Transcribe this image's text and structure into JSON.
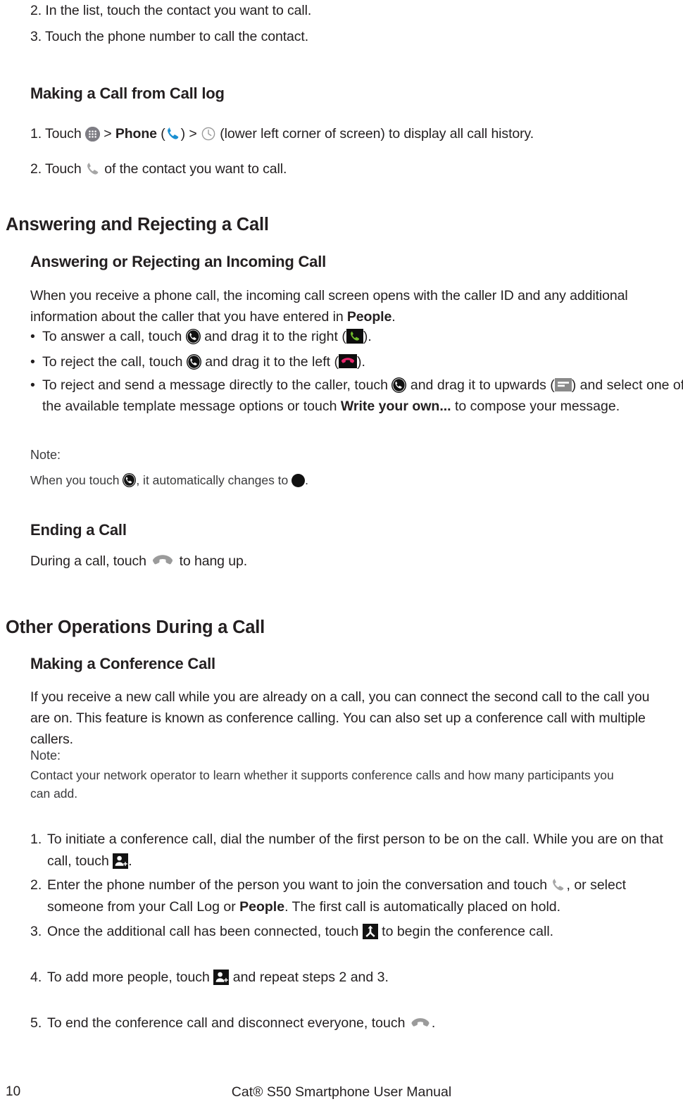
{
  "document": {
    "footer": {
      "page_number": "10",
      "title": "Cat® S50 Smartphone User Manual"
    }
  },
  "top_steps": {
    "step2": "2. In the list, touch the contact you want to call.",
    "step3": "3. Touch the phone number to call the contact."
  },
  "section_call_log": {
    "heading": "Making a Call from Call log",
    "step1_a": "1. Touch ",
    "step1_b": " > ",
    "step1_phone_label": "Phone",
    "step1_c": " (",
    "step1_d": ") > ",
    "step1_e": " (lower left corner of screen) to display all call history.",
    "step2_a": "2. Touch ",
    "step2_b": " of the contact you want to call."
  },
  "section_answer_reject": {
    "heading": "Answering and Rejecting a Call",
    "subheading": "Answering or Rejecting an Incoming Call",
    "intro_a": "When you receive a phone call, the incoming call screen opens with the caller ID and any additional information about the caller that you have entered in ",
    "intro_people": "People",
    "intro_b": ".",
    "bullet1_a": "To answer a call, touch ",
    "bullet1_b": " and drag it to the right (",
    "bullet1_c": ").",
    "bullet2_a": "To reject the call, touch ",
    "bullet2_b": " and drag it to the left (",
    "bullet2_c": ").",
    "bullet3_a": "To reject and send a message directly to the caller, touch ",
    "bullet3_b": " and drag it to upwards (",
    "bullet3_c": ") and select one of the available template message options or touch ",
    "bullet3_bold": "Write your own...",
    "bullet3_d": " to compose your message.",
    "note_label": "Note:",
    "note_a": "When you touch ",
    "note_b": ", it automatically changes to ",
    "note_c": "."
  },
  "section_ending_call": {
    "heading": "Ending a Call",
    "text_a": "During a call, touch ",
    "text_b": " to hang up."
  },
  "section_other_operations": {
    "heading": "Other Operations During a Call",
    "subheading": "Making a Conference Call",
    "paragraph": "If you receive a new call while you are already on a call, you can connect the second call to the call you are on. This feature is known as conference calling. You can also set up a conference call with multiple callers.",
    "note_label": "Note:",
    "note_text": "Contact your network operator to learn whether it supports conference calls and how many participants you can add.",
    "steps": {
      "s1_num": "1.",
      "s1_a": "To initiate a conference call, dial the number of the first person to be on the call. While you are on that call, touch ",
      "s1_b": ".",
      "s2_num": "2.",
      "s2_a": "Enter the phone number of the person you want to join the conversation and touch ",
      "s2_b": ", or select someone from your Call Log or ",
      "s2_people": "People",
      "s2_c": ". The first call is automatically placed on hold.",
      "s3_num": "3.",
      "s3_a": "Once the additional call has been connected, touch ",
      "s3_b": " to begin the conference call.",
      "s4_num": "4.",
      "s4_a": "To add more people, touch ",
      "s4_b": " and repeat steps 2 and 3.",
      "s5_num": "5.",
      "s5_a": "To end the conference call and disconnect everyone, touch ",
      "s5_b": "."
    }
  },
  "icons": {
    "app_drawer": "app-drawer-icon",
    "phone_blue": "phone-handset-blue-icon",
    "phone_gray": "phone-handset-gray-icon",
    "call_history": "clock-icon",
    "answer_circle": "answer-call-circle-icon",
    "black_circle": "filled-black-circle-icon",
    "answer_green": "answer-call-green-icon",
    "reject_pink": "reject-call-pink-icon",
    "message": "message-reject-icon",
    "hangup_gray": "hangup-handset-gray-icon",
    "add_person": "add-person-icon",
    "merge_calls": "merge-calls-icon"
  },
  "colors": {
    "text": "#231f20",
    "note_text": "#3a3a3c",
    "phone_blue": "#1a8fd1",
    "phone_gray": "#a6a6a6",
    "answer_green": "#72c02c",
    "reject_pink": "#e8246b",
    "icon_gray": "#8a8a8a",
    "black": "#111111",
    "background": "#ffffff"
  }
}
